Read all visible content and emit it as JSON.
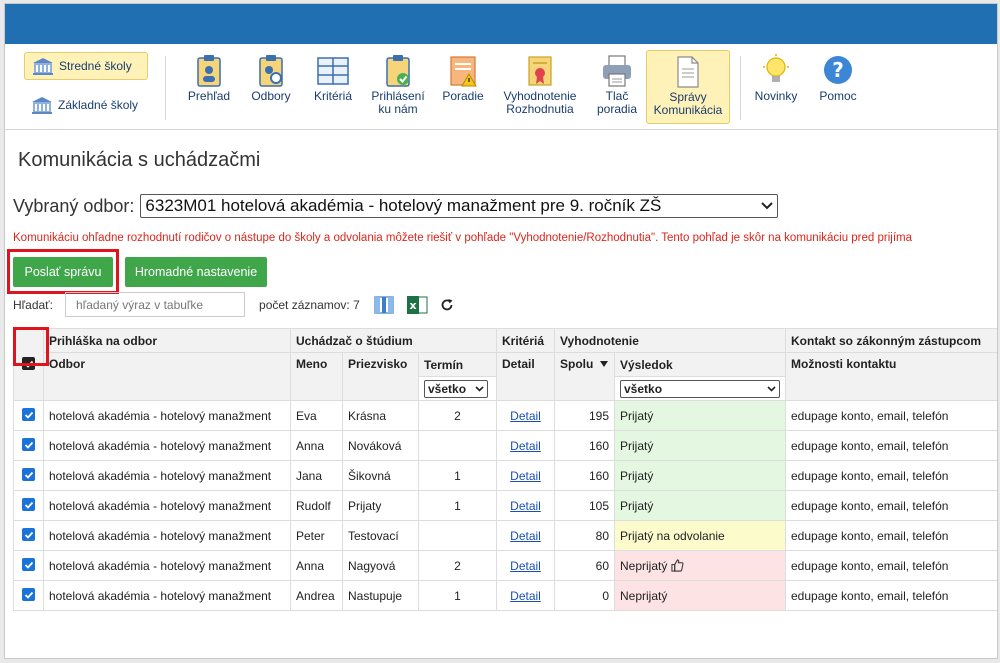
{
  "toolbar": {
    "schools": [
      {
        "label": "Stredné školy",
        "active": true
      },
      {
        "label": "Základné školy",
        "active": false
      }
    ],
    "buttons": [
      {
        "label": "Prehľad",
        "icon": "clipboard-person-icon"
      },
      {
        "label": "Odbory",
        "icon": "clipboard-search-icon"
      },
      {
        "label": "Kritériá",
        "icon": "table-icon"
      },
      {
        "label1": "Prihlásení",
        "label2": "ku nám",
        "icon": "clipboard-check-icon"
      },
      {
        "label": "Poradie",
        "icon": "list-warning-icon"
      },
      {
        "label1": "Vyhodnotenie",
        "label2": "Rozhodnutia",
        "icon": "certificate-icon"
      },
      {
        "label1": "Tlač",
        "label2": "poradia",
        "icon": "printer-icon"
      },
      {
        "label1": "Správy",
        "label2": "Komunikácia",
        "icon": "document-icon",
        "active": true
      },
      {
        "label": "Novinky",
        "icon": "lightbulb-icon"
      },
      {
        "label": "Pomoc",
        "icon": "help-icon"
      }
    ]
  },
  "page": {
    "title": "Komunikácia s uchádzačmi",
    "odbor_label": "Vybraný odbor:",
    "odbor_value": "6323M01 hotelová akadémia - hotelový manažment pre 9. ročník ZŠ",
    "warning": "Komunikáciu ohľadne rozhodnutí rodičov o nástupe do školy a odvolania môžete riešiť v pohľade \"Vyhodnotenie/Rozhodnutia\". Tento pohľad je skôr na komunikáciu pred prijíma",
    "send_button": "Poslať správu",
    "bulk_button": "Hromadné nastavenie",
    "search_label": "Hľadať:",
    "search_placeholder": "hľadaný výraz v tabuľke",
    "count_text": "počet záznamov: 7"
  },
  "table": {
    "group_headers": {
      "prihlaska": "Prihláška na odbor",
      "uchadzac": "Uchádzač o štúdium",
      "kriteria": "Kritériá",
      "vyhodnotenie": "Vyhodnotenie",
      "kontakt": "Kontakt so zákonným zástupcom"
    },
    "col_headers": {
      "odbor": "Odbor",
      "meno": "Meno",
      "priezvisko": "Priezvisko",
      "termin": "Termín",
      "detail": "Detail",
      "spolu": "Spolu",
      "vysledok": "Výsledok",
      "moznosti": "Možnosti kontaktu"
    },
    "filters": {
      "termin": "všetko",
      "vysledok": "všetko"
    },
    "rows": [
      {
        "odbor": "hotelová akadémia - hotelový manažment",
        "meno": "Eva",
        "priezvisko": "Krásna",
        "termin": "2",
        "detail": "Detail",
        "spolu": "195",
        "vysledok": "Prijatý",
        "status": "green",
        "kontakt": "edupage konto, email, telefón"
      },
      {
        "odbor": "hotelová akadémia - hotelový manažment",
        "meno": "Anna",
        "priezvisko": "Nováková",
        "termin": "",
        "detail": "Detail",
        "spolu": "160",
        "vysledok": "Prijatý",
        "status": "green",
        "kontakt": "edupage konto, email, telefón"
      },
      {
        "odbor": "hotelová akadémia - hotelový manažment",
        "meno": "Jana",
        "priezvisko": "Šikovná",
        "termin": "1",
        "detail": "Detail",
        "spolu": "160",
        "vysledok": "Prijatý",
        "status": "green",
        "kontakt": "edupage konto, email, telefón"
      },
      {
        "odbor": "hotelová akadémia - hotelový manažment",
        "meno": "Rudolf",
        "priezvisko": "Prijaty",
        "termin": "1",
        "detail": "Detail",
        "spolu": "105",
        "vysledok": "Prijatý",
        "status": "green",
        "kontakt": "edupage konto, email, telefón"
      },
      {
        "odbor": "hotelová akadémia - hotelový manažment",
        "meno": "Peter",
        "priezvisko": "Testovací",
        "termin": "",
        "detail": "Detail",
        "spolu": "80",
        "vysledok": "Prijatý na odvolanie",
        "status": "yellow",
        "kontakt": "edupage konto, email, telefón"
      },
      {
        "odbor": "hotelová akadémia - hotelový manažment",
        "meno": "Anna",
        "priezvisko": "Nagyová",
        "termin": "2",
        "detail": "Detail",
        "spolu": "60",
        "vysledok": "Neprijatý",
        "status": "red",
        "thumb": true,
        "kontakt": "edupage konto, email, telefón"
      },
      {
        "odbor": "hotelová akadémia - hotelový manažment",
        "meno": "Andrea",
        "priezvisko": "Nastupuje",
        "termin": "1",
        "detail": "Detail",
        "spolu": "0",
        "vysledok": "Neprijatý",
        "status": "red",
        "kontakt": "edupage konto, email, telefón"
      }
    ]
  },
  "colors": {
    "accent": "#1f6fb2",
    "green_button": "#3fa64a",
    "warning": "#d9261c",
    "highlight": "#e0141e"
  }
}
